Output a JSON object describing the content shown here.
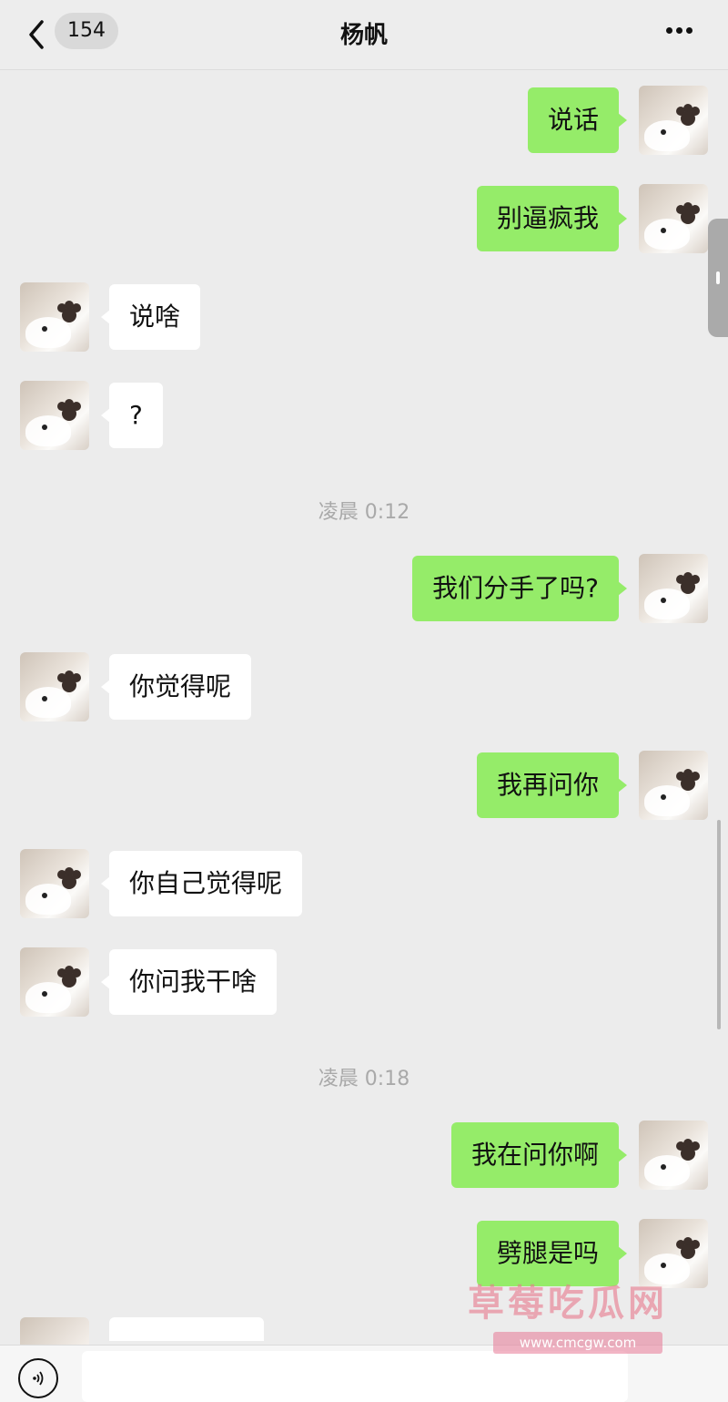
{
  "header": {
    "back_icon": "chevron-left-icon",
    "unread_count": "154",
    "title": "杨帆",
    "more_icon": "ellipsis-icon"
  },
  "colors": {
    "outgoing_bubble": "#95ec69",
    "incoming_bubble": "#ffffff",
    "background": "#ececec"
  },
  "messages": [
    {
      "direction": "out",
      "text": "说话"
    },
    {
      "direction": "out",
      "text": "别逼疯我"
    },
    {
      "direction": "in",
      "text": "说啥"
    },
    {
      "direction": "in",
      "text": "?"
    },
    {
      "type": "time",
      "text": "凌晨 0:12"
    },
    {
      "direction": "out",
      "text": "我们分手了吗?"
    },
    {
      "direction": "in",
      "text": "你觉得呢"
    },
    {
      "direction": "out",
      "text": "我再问你"
    },
    {
      "direction": "in",
      "text": "你自己觉得呢"
    },
    {
      "direction": "in",
      "text": "你问我干啥"
    },
    {
      "type": "time",
      "text": "凌晨 0:18"
    },
    {
      "direction": "out",
      "text": "我在问你啊"
    },
    {
      "direction": "out",
      "text": "劈腿是吗"
    }
  ],
  "input_bar": {
    "voice_icon": "voice-icon"
  },
  "watermark": {
    "brand": "草莓吃瓜网",
    "url": "www.cmcgw.com"
  }
}
